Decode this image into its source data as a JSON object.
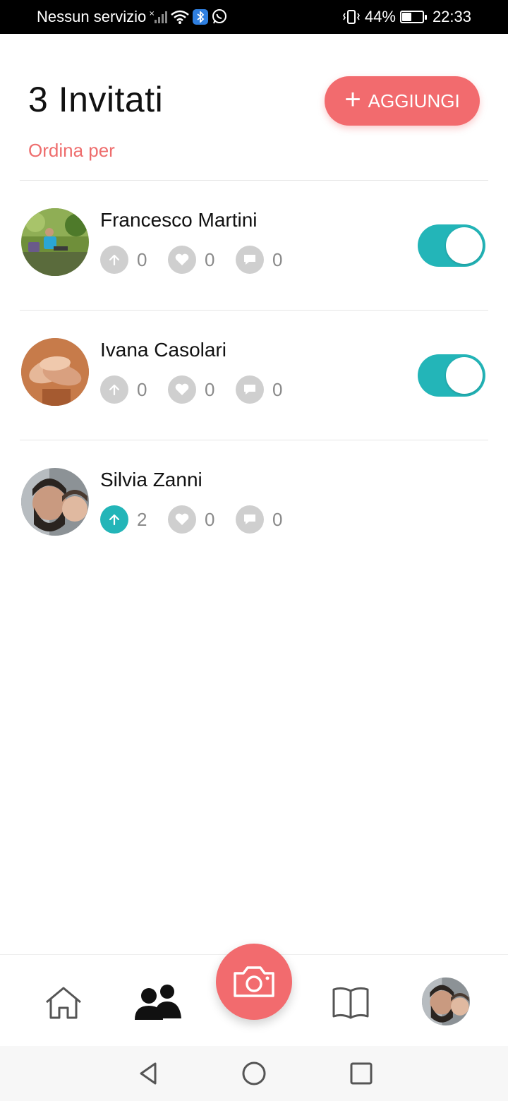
{
  "status_bar": {
    "carrier": "Nessun servizio",
    "battery_percent": "44%",
    "battery_level": 0.44,
    "time": "22:33"
  },
  "header": {
    "title": "3 Invitati",
    "add_button_label": "AGGIUNGI",
    "sort_label": "Ordina per"
  },
  "colors": {
    "accent": "#f26b6e",
    "teal": "#23b5b8",
    "stat_gray": "#cfcfcf"
  },
  "guests": [
    {
      "name": "Francesco Martini",
      "uploads": "0",
      "likes": "0",
      "comments": "0",
      "upload_active": false,
      "toggle": "on"
    },
    {
      "name": "Ivana Casolari",
      "uploads": "0",
      "likes": "0",
      "comments": "0",
      "upload_active": false,
      "toggle": "on"
    },
    {
      "name": "Silvia Zanni",
      "uploads": "2",
      "likes": "0",
      "comments": "0",
      "upload_active": true,
      "toggle": "none"
    }
  ],
  "bottom_nav": {
    "items": [
      "home-icon",
      "people-icon",
      "camera-icon",
      "book-icon",
      "profile-avatar"
    ],
    "active": "people-icon"
  },
  "system_nav": [
    "back-icon",
    "home-circle-icon",
    "recents-icon"
  ]
}
